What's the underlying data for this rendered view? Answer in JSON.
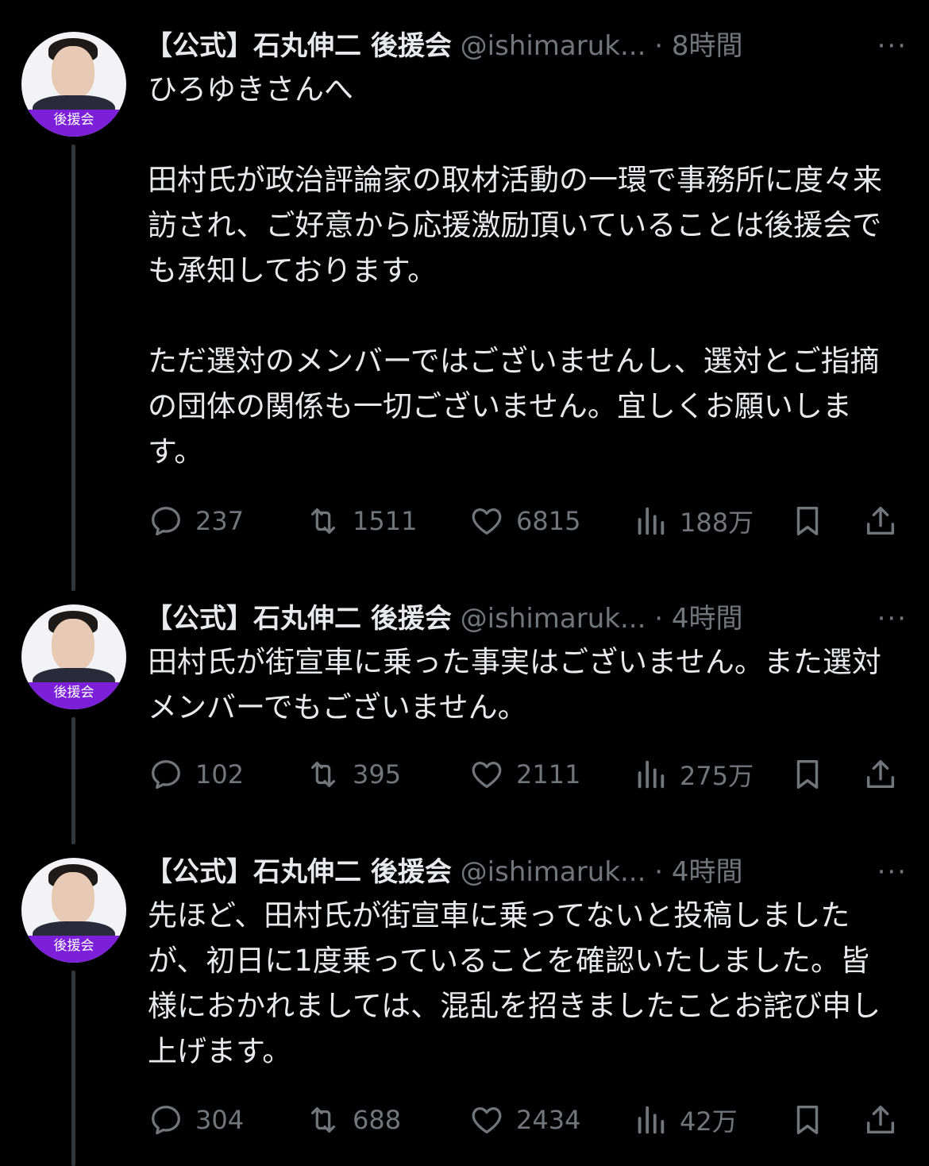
{
  "tweets": [
    {
      "author_name": "【公式】石丸伸二 後援会",
      "handle": "@ishimaruk...",
      "separator": "·",
      "time": "8時間",
      "more": "···",
      "avatar_label": "後援会",
      "paragraphs": [
        "ひろゆきさんへ",
        "田村氏が政治評論家の取材活動の一環で事務所に度々来訪され、ご好意から応援激励頂いていることは後援会でも承知しております。",
        "ただ選対のメンバーではございませんし、選対とご指摘の団体の関係も一切ございません。宜しくお願いします。"
      ],
      "stats": {
        "replies": "237",
        "retweets": "1511",
        "likes": "6815",
        "views": "188万"
      }
    },
    {
      "author_name": "【公式】石丸伸二 後援会",
      "handle": "@ishimaruk...",
      "separator": "·",
      "time": "4時間",
      "more": "···",
      "avatar_label": "後援会",
      "paragraphs": [
        "田村氏が街宣車に乗った事実はございません。また選対メンバーでもございません。"
      ],
      "stats": {
        "replies": "102",
        "retweets": "395",
        "likes": "2111",
        "views": "275万"
      }
    },
    {
      "author_name": "【公式】石丸伸二 後援会",
      "handle": "@ishimaruk...",
      "separator": "·",
      "time": "4時間",
      "more": "···",
      "avatar_label": "後援会",
      "paragraphs": [
        "先ほど、田村氏が街宣車に乗ってないと投稿しましたが、初日に1度乗っていることを確認いたしました。皆様におかれましては、混乱を招きましたことお詫び申し上げます。"
      ],
      "stats": {
        "replies": "304",
        "retweets": "688",
        "likes": "2434",
        "views": "42万"
      }
    }
  ],
  "icons": {
    "reply": "speech-bubble-icon",
    "retweet": "retweet-arrows-icon",
    "like": "heart-icon",
    "views": "bar-chart-icon",
    "bookmark": "bookmark-icon",
    "share": "share-upload-icon"
  },
  "colors": {
    "background": "#000000",
    "text": "#e7e9ea",
    "muted": "#71767b",
    "avatar_band": "#7b1fd8",
    "thread_line": "#333639"
  }
}
